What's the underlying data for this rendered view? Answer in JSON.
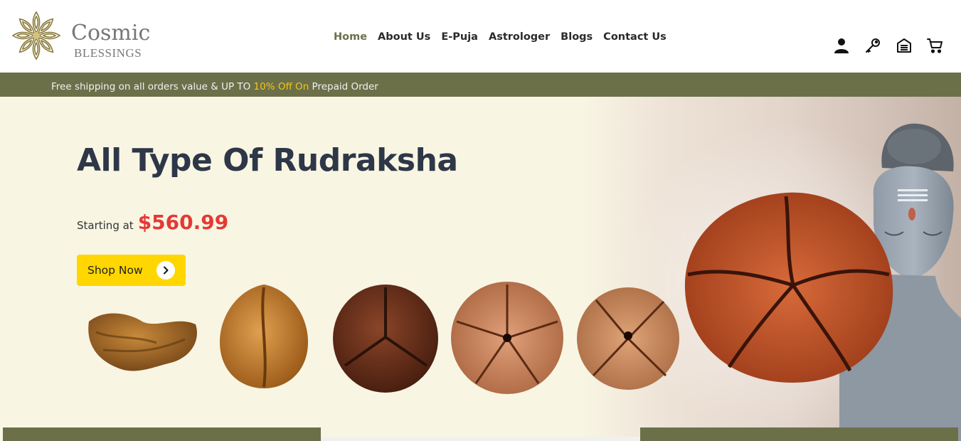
{
  "brand": {
    "name_main": "Cosmic",
    "name_sub": "BLESSINGS",
    "color": "#8a7a3a"
  },
  "nav": {
    "items": [
      {
        "label": "Home",
        "active": true
      },
      {
        "label": "About Us",
        "active": false
      },
      {
        "label": "E-Puja",
        "active": false
      },
      {
        "label": "Astrologer",
        "active": false
      },
      {
        "label": "Blogs",
        "active": false
      },
      {
        "label": "Contact Us",
        "active": false
      }
    ]
  },
  "header_icons": [
    "user-icon",
    "key-icon",
    "bank-icon",
    "cart-icon"
  ],
  "promo": {
    "text_before": "Free shipping on all orders value & UP TO ",
    "highlight": "10% Off On",
    "text_after": " Prepaid Order",
    "bg_color": "#6b7049",
    "highlight_color": "#f5c518"
  },
  "hero": {
    "title": "All Type Of Rudraksha",
    "price_label": "Starting at",
    "price_value": "$560.99",
    "button_label": "Shop Now",
    "title_color": "#2d3748",
    "price_color": "#e53935",
    "button_color": "#ffd600"
  }
}
